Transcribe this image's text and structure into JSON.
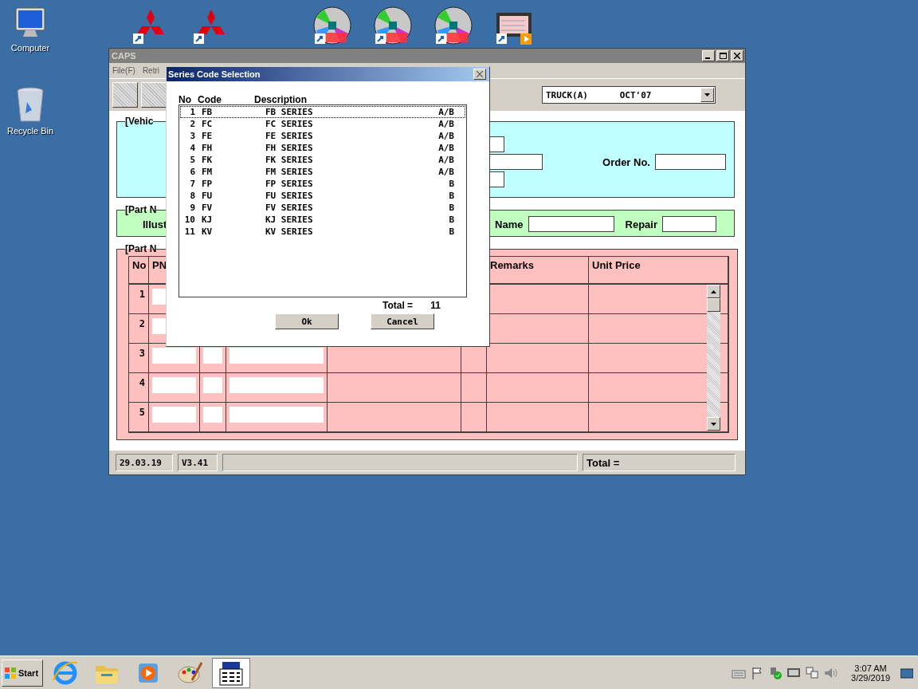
{
  "desktop": {
    "icons": [
      {
        "label": "Computer",
        "kind": "computer"
      },
      {
        "label": "Recycle Bin",
        "kind": "recycle"
      }
    ],
    "shortcuts": [
      {
        "kind": "diamonds"
      },
      {
        "kind": "diamonds"
      },
      {
        "kind": "disc"
      },
      {
        "kind": "disc"
      },
      {
        "kind": "disc"
      },
      {
        "kind": "film"
      }
    ]
  },
  "window": {
    "title": "CAPS",
    "menu": [
      "File(F)",
      "Retri"
    ],
    "model_select": {
      "value": "TRUCK(A)      OCT'07"
    },
    "vehicle_panel": {
      "label": "[Vehic",
      "order_no_label": "Order No."
    },
    "part_panel": {
      "label": "[Part N",
      "illust_label": "Illust",
      "name_label": "Name",
      "repair_label": "Repair"
    },
    "parts_table": {
      "label": "[Part N",
      "columns": [
        "No",
        "PN",
        "Remarks",
        "Unit Price"
      ],
      "rows": [
        "1",
        "2",
        "3",
        "4",
        "5"
      ]
    },
    "status_bar": {
      "date": "29.03.19",
      "version": "V3.41",
      "total_label": "Total ="
    }
  },
  "dialog": {
    "title": "Series Code Selection",
    "headers": [
      "No",
      "Code",
      "Description"
    ],
    "rows": [
      {
        "no": "1",
        "code": "FB",
        "description": "FB SERIES",
        "type": "A/B",
        "selected": true
      },
      {
        "no": "2",
        "code": "FC",
        "description": "FC SERIES",
        "type": "A/B",
        "selected": false
      },
      {
        "no": "3",
        "code": "FE",
        "description": "FE SERIES",
        "type": "A/B",
        "selected": false
      },
      {
        "no": "4",
        "code": "FH",
        "description": "FH SERIES",
        "type": "A/B",
        "selected": false
      },
      {
        "no": "5",
        "code": "FK",
        "description": "FK SERIES",
        "type": "A/B",
        "selected": false
      },
      {
        "no": "6",
        "code": "FM",
        "description": "FM SERIES",
        "type": "A/B",
        "selected": false
      },
      {
        "no": "7",
        "code": "FP",
        "description": "FP SERIES",
        "type": "B",
        "selected": false
      },
      {
        "no": "8",
        "code": "FU",
        "description": "FU SERIES",
        "type": "B",
        "selected": false
      },
      {
        "no": "9",
        "code": "FV",
        "description": "FV SERIES",
        "type": "B",
        "selected": false
      },
      {
        "no": "10",
        "code": "KJ",
        "description": "KJ SERIES",
        "type": "B",
        "selected": false
      },
      {
        "no": "11",
        "code": "KV",
        "description": "KV SERIES",
        "type": "B",
        "selected": false
      }
    ],
    "total_label": "Total =",
    "total": "11",
    "buttons": [
      "Ok",
      "Cancel"
    ]
  },
  "taskbar": {
    "start": "Start",
    "apps": [
      {
        "kind": "browser",
        "selected": false
      },
      {
        "kind": "folder",
        "selected": false
      },
      {
        "kind": "media",
        "selected": false
      },
      {
        "kind": "paint",
        "selected": false
      },
      {
        "kind": "app",
        "selected": true
      }
    ],
    "tray": [
      {
        "kind": "keyboard"
      },
      {
        "kind": "flag"
      },
      {
        "kind": "shield"
      },
      {
        "kind": "vm"
      },
      {
        "kind": "network"
      },
      {
        "kind": "speaker"
      }
    ],
    "time": "3:07 AM",
    "date": "3/29/2019"
  }
}
